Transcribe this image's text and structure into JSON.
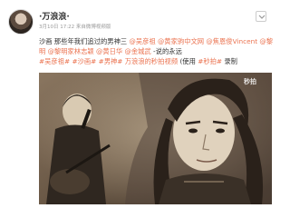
{
  "post": {
    "username": "·万浪浪·",
    "meta": "3月10日 17:22 来自微博视频版",
    "content": {
      "line1_plain": "沙画 那些年我们追过的男神三 ",
      "mention1": "@吴彦祖",
      "mention2": " @黄家驹中文网",
      "mention3": " @焦恩俊Vincent",
      "mention4": " @黎明",
      "mention5": " @黎明家林志颖",
      "mention6": " @黄日华",
      "mention7": " @金城武",
      "line2_plain": " -说的永远",
      "topic1": "#吴彦祖#",
      "topic2": " #沙画# #男神#",
      "video_link": " 万浪浪的秒拍视频",
      "suffix_open": " (使用 ",
      "topic3": "#秒拍#",
      "suffix_close": " 录制"
    },
    "watermark": "秒拍"
  },
  "colors": {
    "link": "#eb7350",
    "text": "#333333",
    "meta": "#999999"
  }
}
